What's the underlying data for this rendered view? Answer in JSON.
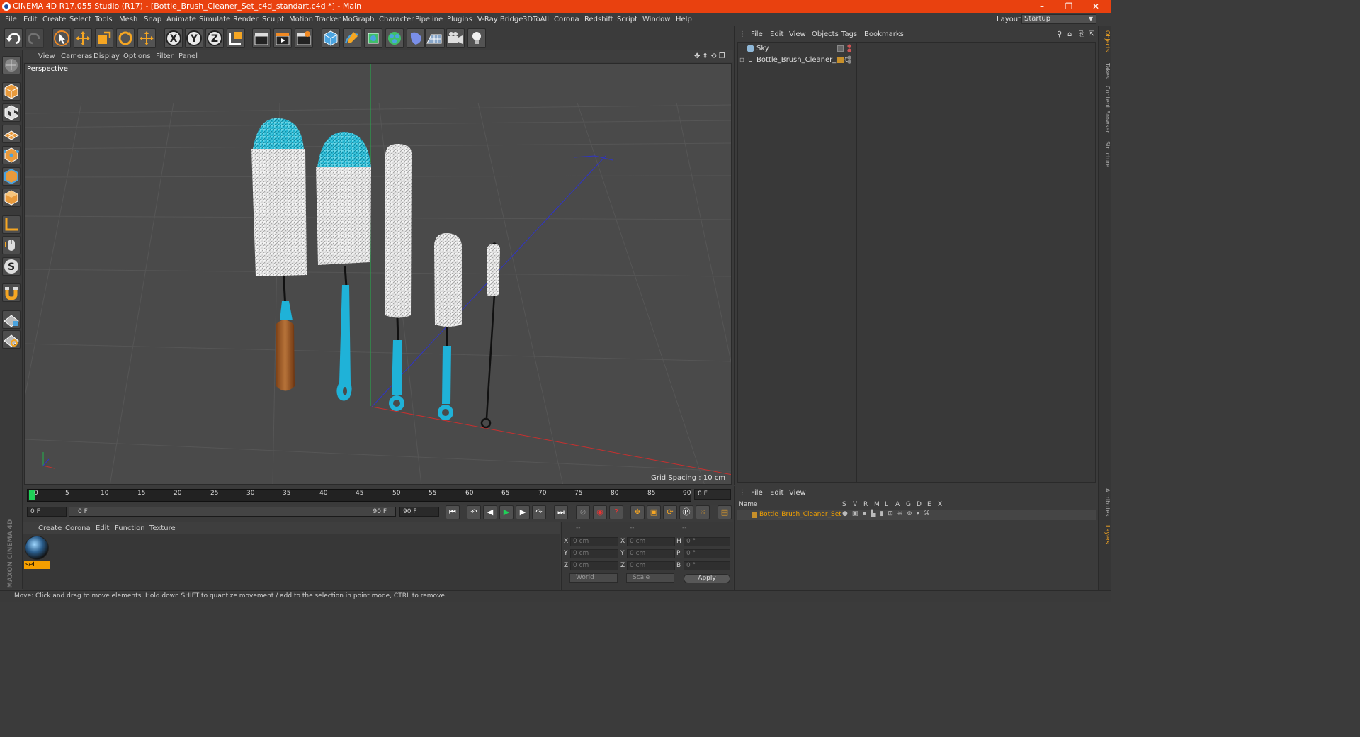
{
  "title": "CINEMA 4D R17.055 Studio (R17) - [Bottle_Brush_Cleaner_Set_c4d_standart.c4d *] - Main",
  "window_controls": [
    "–",
    "❐",
    "✕"
  ],
  "menu": [
    "File",
    "Edit",
    "Create",
    "Select",
    "Tools",
    "Mesh",
    "Snap",
    "Animate",
    "Simulate",
    "Render",
    "Sculpt",
    "Motion Tracker",
    "MoGraph",
    "Character",
    "Pipeline",
    "Plugins",
    "V-Ray Bridge",
    "3DToAll",
    "Corona",
    "Redshift",
    "Script",
    "Window",
    "Help"
  ],
  "layout": {
    "label": "Layout:",
    "value": "Startup"
  },
  "viewport": {
    "menu": [
      "View",
      "Cameras",
      "Display",
      "Options",
      "Filter",
      "Panel"
    ],
    "label": "Perspective",
    "grid_spacing": "Grid Spacing : 10 cm"
  },
  "timeline": {
    "ticks": [
      "0",
      "5",
      "10",
      "15",
      "20",
      "25",
      "30",
      "35",
      "40",
      "45",
      "50",
      "55",
      "60",
      "65",
      "70",
      "75",
      "80",
      "85",
      "90"
    ],
    "current_frame": "0 F",
    "start_field": "0 F",
    "range_start": "0 F",
    "range_end": "90 F",
    "end_field": "90 F"
  },
  "material_manager": {
    "menu": [
      "Create",
      "Corona",
      "Edit",
      "Function",
      "Texture"
    ],
    "material_name": "set"
  },
  "coordinates": {
    "headers": [
      "--",
      "--",
      "--"
    ],
    "rows": [
      {
        "a": "X",
        "av": "0 cm",
        "b": "X",
        "bv": "0 cm",
        "c": "H",
        "cv": "0 °"
      },
      {
        "a": "Y",
        "av": "0 cm",
        "b": "Y",
        "bv": "0 cm",
        "c": "P",
        "cv": "0 °"
      },
      {
        "a": "Z",
        "av": "0 cm",
        "b": "Z",
        "bv": "0 cm",
        "c": "B",
        "cv": "0 °"
      }
    ],
    "mode1": "World",
    "mode2": "Scale",
    "apply": "Apply"
  },
  "object_manager": {
    "menu": [
      "File",
      "Edit",
      "View",
      "Objects",
      "Tags",
      "Bookmarks"
    ],
    "objects": [
      "Sky",
      "Bottle_Brush_Cleaner_Set"
    ]
  },
  "attribute_manager": {
    "menu": [
      "File",
      "Edit",
      "View"
    ],
    "header_name": "Name",
    "columns": [
      "S",
      "V",
      "R",
      "M",
      "L",
      "A",
      "G",
      "D",
      "E",
      "X"
    ],
    "row_name": "Bottle_Brush_Cleaner_Set"
  },
  "side_tabs": [
    "Objects",
    "Takes",
    "Content Browser",
    "Structure"
  ],
  "side_tabs_bottom": [
    "Attributes",
    "Layers"
  ],
  "branding": "MAXON CINEMA 4D",
  "status": "Move: Click and drag to move elements. Hold down SHIFT to quantize movement / add to the selection in point mode, CTRL to remove.",
  "colors": {
    "title_bar": "#e9410f",
    "brush_accent": "#1fb2d8",
    "material_highlight": "#f59f00"
  }
}
